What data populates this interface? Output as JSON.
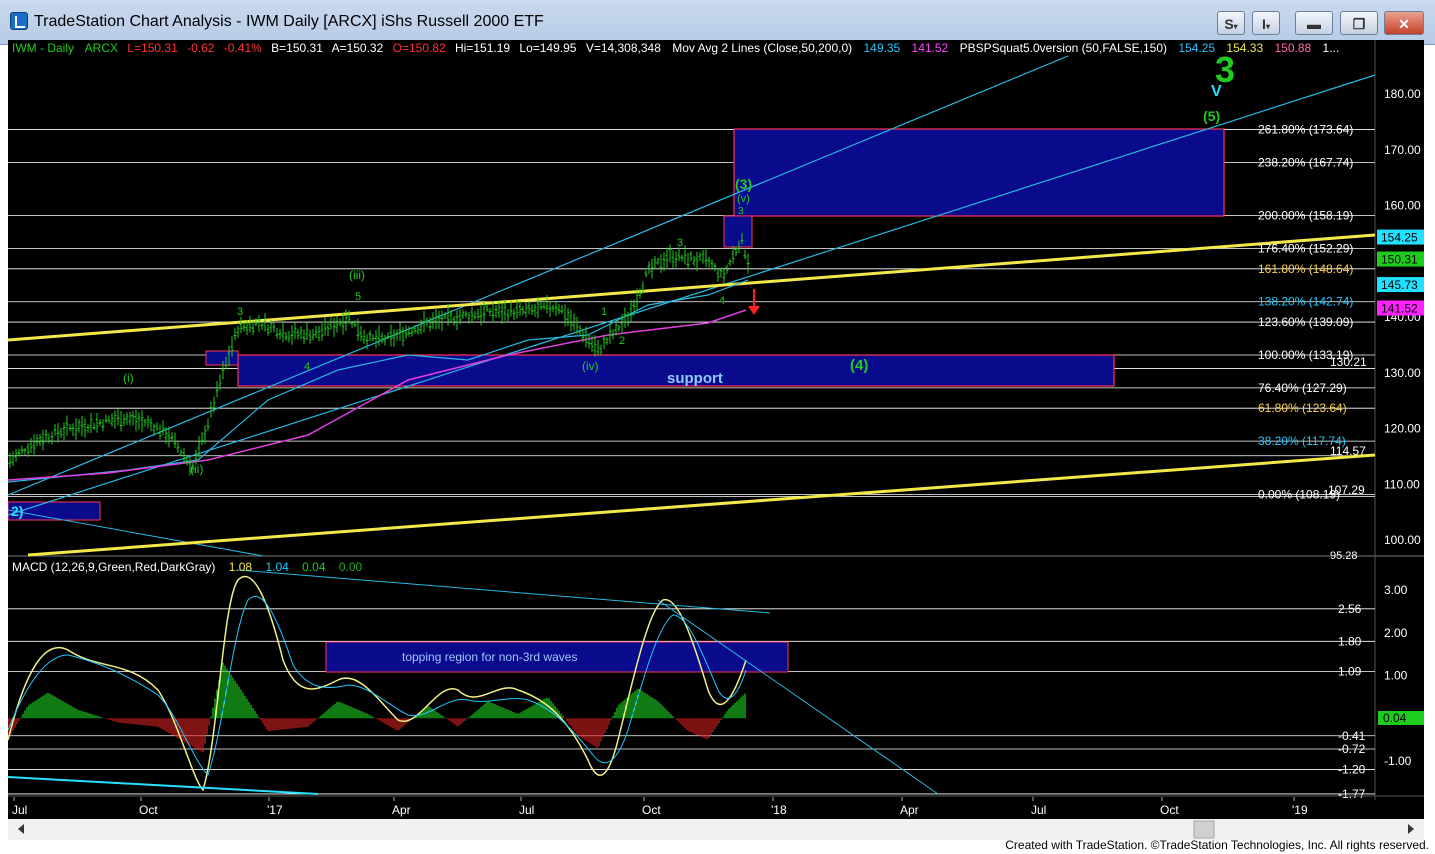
{
  "window": {
    "title": "TradeStation Chart Analysis - IWM Daily [ARCX] iShs Russell 2000 ETF",
    "s_button": "S",
    "i_button": "I",
    "minimize_label": "▬",
    "restore_label": "❐",
    "close_label": "✕"
  },
  "info_bar": {
    "symbol": "IWM - Daily",
    "exchange": "ARCX",
    "last": "L=150.31",
    "change": "-0.62",
    "change_pct": "-0.41%",
    "bid": "B=150.31",
    "ask": "A=150.32",
    "open": "O=150.82",
    "high": "Hi=151.19",
    "low": "Lo=149.95",
    "volume": "V=14,308,348",
    "indicator1": "Mov Avg 2 Lines (Close,50,200,0)",
    "ma1": "149.35",
    "ma2": "141.52",
    "indicator2": "PBSPSquat5.0version (50,FALSE,150)",
    "pv1": "154.25",
    "pv2": "154.33",
    "pv3": "150.88",
    "pv4": "1..."
  },
  "price_axis": [
    "180.00",
    "170.00",
    "160.00",
    "150.00",
    "140.00",
    "130.00",
    "120.00",
    "110.00",
    "100.00"
  ],
  "fib_levels": [
    {
      "label": "261.80% (173.64)",
      "color": "#ffffff"
    },
    {
      "label": "238.20% (167.74)",
      "color": "#ffffff"
    },
    {
      "label": "200.00% (158.19)",
      "color": "#ffffff"
    },
    {
      "label": "176.40% (152.29)",
      "color": "#ffffff"
    },
    {
      "label": "161.80% (148.64)",
      "color": "#ffd24d"
    },
    {
      "label": "138.20% (142.74)",
      "color": "#22c7ff"
    },
    {
      "label": "123.60% (139.09)",
      "color": "#ffffff"
    },
    {
      "label": "100.00% (133.19)",
      "color": "#ffffff"
    },
    {
      "label": "76.40% (127.29)",
      "color": "#ffffff"
    },
    {
      "label": "61.80% (123.64)",
      "color": "#ffd24d"
    },
    {
      "label": "38.20% (117.74)",
      "color": "#22c7ff"
    },
    {
      "label": "0.00% (108.19)",
      "color": "#ffffff"
    }
  ],
  "extra_price_labels": {
    "p130": "130.21",
    "p114": "114.57",
    "p107": "107.29",
    "p95": "95.28"
  },
  "price_tags": [
    {
      "value": "154.25",
      "bg": "#22e0ff"
    },
    {
      "value": "150.31",
      "bg": "#1ecc1e"
    },
    {
      "value": "145.73",
      "bg": "#22e0ff"
    },
    {
      "value": "141.52",
      "bg": "#ff22ff"
    }
  ],
  "wave_labels": {
    "big3": "3",
    "v_big": "V",
    "w5": "(5)",
    "w3": "(3)",
    "wv": "(v)",
    "w3small": "3",
    "w3b": "3",
    "w1": "1",
    "w2": "2",
    "w4": "4",
    "iii": "(iii)",
    "w5s": "5",
    "w3c": "3",
    "w4b": "4",
    "i": "(i)",
    "ii": "(ii)",
    "iv": "(iv)",
    "w4c": "(4)",
    "w2big": "2)"
  },
  "support_label": "support",
  "macd": {
    "title": "MACD (12,26,9,Green,Red,DarkGray)",
    "v1": "1.08",
    "v2": "1.04",
    "v3": "0.04",
    "v4": "0.00",
    "axis": [
      "3.00",
      "2.00",
      "1.00",
      "-1.00"
    ],
    "levels": [
      "2.56",
      "1.80",
      "1.09",
      "-0.41",
      "-0.72",
      "-1.20",
      "-1.77"
    ],
    "tag": "0.04",
    "box_label": "topping region for non-3rd waves"
  },
  "date_axis": [
    "Jul",
    "Oct",
    "'17",
    "Apr",
    "Jul",
    "Oct",
    "'18",
    "Apr",
    "Jul",
    "Oct",
    "'19"
  ],
  "footer": "Created with TradeStation. ©TradeStation Technologies, Inc. All rights reserved."
}
